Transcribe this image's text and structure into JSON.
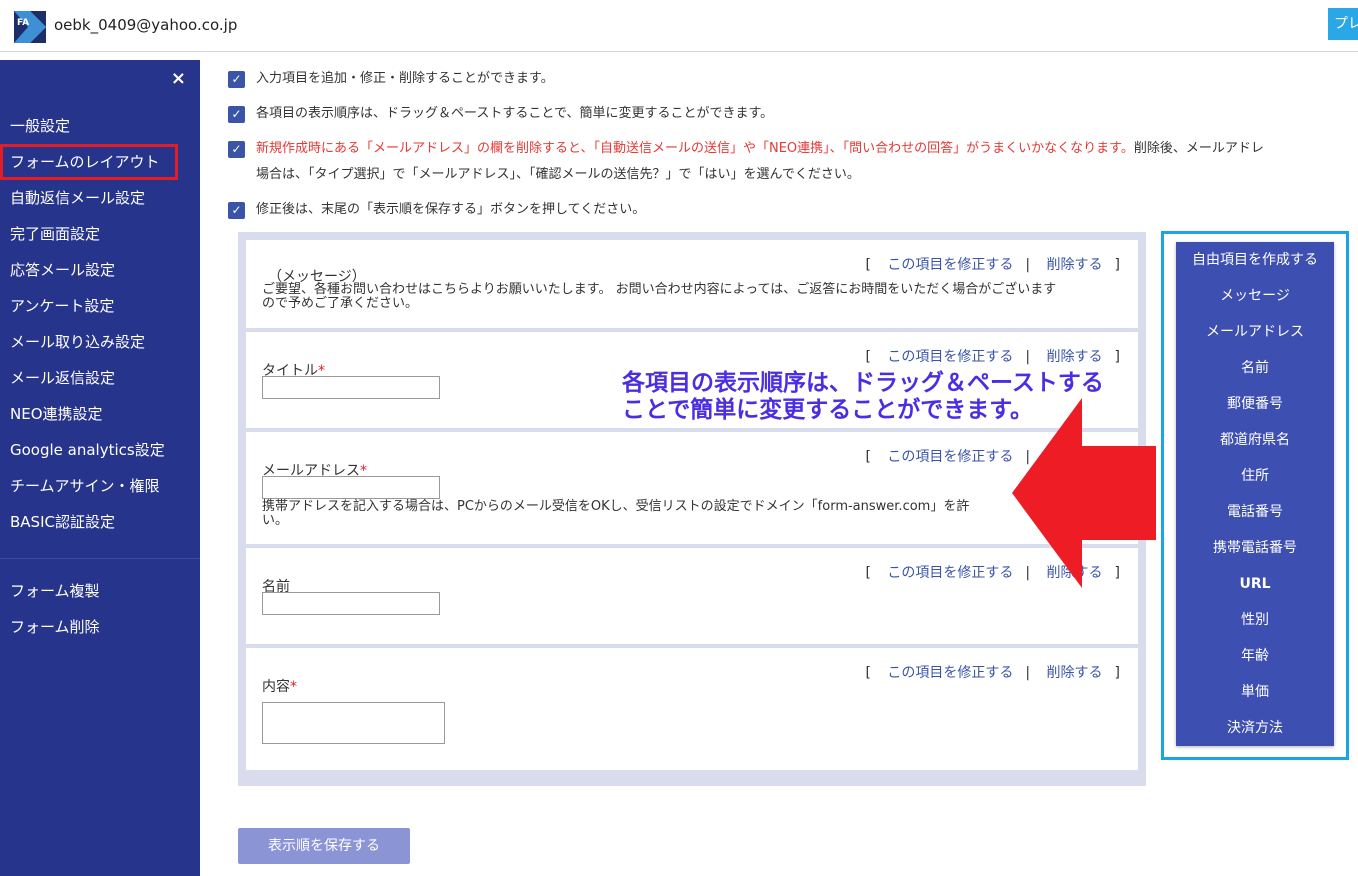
{
  "header": {
    "email": "oebk_0409@yahoo.co.jp",
    "preview_label": "プレ"
  },
  "sidebar": {
    "close": "×",
    "items": [
      {
        "label": "一般設定"
      },
      {
        "label": "フォームのレイアウト"
      },
      {
        "label": "自動返信メール設定"
      },
      {
        "label": "完了画面設定"
      },
      {
        "label": "応答メール設定"
      },
      {
        "label": "アンケート設定"
      },
      {
        "label": "メール取り込み設定"
      },
      {
        "label": "メール返信設定"
      },
      {
        "label": "NEO連携設定"
      },
      {
        "label": "Google analytics設定"
      },
      {
        "label": "チームアサイン・権限"
      },
      {
        "label": "BASIC認証設定"
      }
    ],
    "secondary": [
      {
        "label": "フォーム複製"
      },
      {
        "label": "フォーム削除"
      }
    ]
  },
  "notices": {
    "n1": "入力項目を追加・修正・削除することができます。",
    "n2": "各項目の表示順序は、ドラッグ＆ペーストすることで、簡単に変更することができます。",
    "n3_red": "新規作成時にある「メールアドレス」の欄を削除すると、「自動送信メールの送信」や「NEO連携」、「問い合わせの回答」がうまくいかなくなります。",
    "n3_rest": "削除後、メールアドレ",
    "n3_line2": "場合は、「タイプ選択」で「メールアドレス」、「確認メールの送信先？」で「はい」を選んでください。",
    "n4": "修正後は、末尾の「表示順を保存する」ボタンを押してください。"
  },
  "fields": {
    "edit_label": "この項目を修正する",
    "delete_label": "削除する",
    "bracket_open": "[",
    "bracket_close": "]",
    "pipe": "|",
    "required_mark": "*",
    "message": {
      "label": "（メッセージ）",
      "text_line1": "ご要望、各種お問い合わせはこちらよりお願いいたします。 お問い合わせ内容によっては、ご返答にお時間をいただく場合がございます",
      "text_line2": "ので予めご了承ください。"
    },
    "title": {
      "label": "タイトル"
    },
    "email": {
      "label": "メールアドレス",
      "help_line1": "携帯アドレスを記入する場合は、PCからのメール受信をOKし、受信リストの設定でドメイン「form-answer.com」を許",
      "help_line2": "い。"
    },
    "name": {
      "label": "名前"
    },
    "content": {
      "label": "内容"
    }
  },
  "palette": {
    "items": [
      {
        "label": "自由項目を作成する"
      },
      {
        "label": "メッセージ"
      },
      {
        "label": "メールアドレス"
      },
      {
        "label": "名前"
      },
      {
        "label": "郵便番号"
      },
      {
        "label": "都道府県名"
      },
      {
        "label": "住所"
      },
      {
        "label": "電話番号"
      },
      {
        "label": "携帯電話番号"
      },
      {
        "label": "URL"
      },
      {
        "label": "性別"
      },
      {
        "label": "年齢"
      },
      {
        "label": "単価"
      },
      {
        "label": "決済方法"
      }
    ]
  },
  "save_button": "表示順を保存する",
  "callout": {
    "line1": "各項目の表示順序は、ドラッグ＆ペーストする",
    "line2": "ことで簡単に変更することができます。"
  },
  "colors": {
    "sidebar": "#27348b",
    "active_border": "#e21d26",
    "palette": "#3d4fb0",
    "palette_frame": "#1aa6e0",
    "callout": "#4b2ee3",
    "arrow": "#ee1c25"
  },
  "icons": {
    "logo": "logo-icon",
    "close": "close-icon",
    "checkbox": "checkbox-checked-icon",
    "arrow": "left-arrow-icon"
  }
}
